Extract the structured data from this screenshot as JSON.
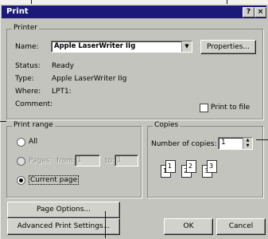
{
  "window": {
    "title": "Print",
    "help_label": "?",
    "close_label": "×"
  },
  "printer": {
    "legend": "Printer",
    "name_label": "Name:",
    "name_value": "Apple LaserWriter IIg",
    "properties_button": "Properties...",
    "status_label": "Status:",
    "status_value": "Ready",
    "type_label": "Type:",
    "type_value": "Apple LaserWriter IIg",
    "where_label": "Where:",
    "where_value": "LPT1:",
    "comment_label": "Comment:",
    "print_to_file_label": "Print to file",
    "print_to_file_checked": false
  },
  "print_range": {
    "legend": "Print range",
    "all_label": "All",
    "pages_label": "Pages",
    "from_label": "from:",
    "from_value": "1",
    "to_label": "to:",
    "to_value": "1",
    "current_page_label": "Current page",
    "selected": "current_page"
  },
  "copies": {
    "legend": "Copies",
    "number_label": "Number of copies:",
    "number_value": "1",
    "collate_pages": [
      "1",
      "1",
      "2",
      "2",
      "3",
      "3"
    ]
  },
  "buttons": {
    "page_options": "Page Options...",
    "advanced_settings": "Advanced Print Settings...",
    "ok": "OK",
    "cancel": "Cancel"
  }
}
